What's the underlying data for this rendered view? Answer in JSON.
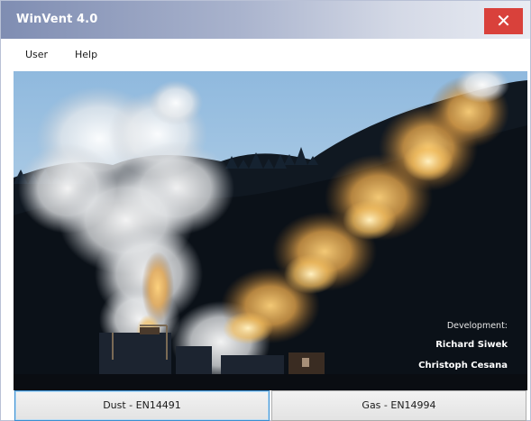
{
  "window": {
    "title": "WinVent 4.0",
    "close_icon": "close-icon",
    "colors": {
      "titlebar_start": "#7f8db2",
      "close": "#d9413b"
    }
  },
  "menu": {
    "items": [
      "User",
      "Help"
    ]
  },
  "splash": {
    "image": "vent-explosion-photo",
    "credits_heading": "Development:",
    "credits_names": [
      "Richard Siwek",
      "Christoph Cesana"
    ]
  },
  "buttons": {
    "dust": "Dust - EN14491",
    "gas": "Gas - EN14994"
  }
}
